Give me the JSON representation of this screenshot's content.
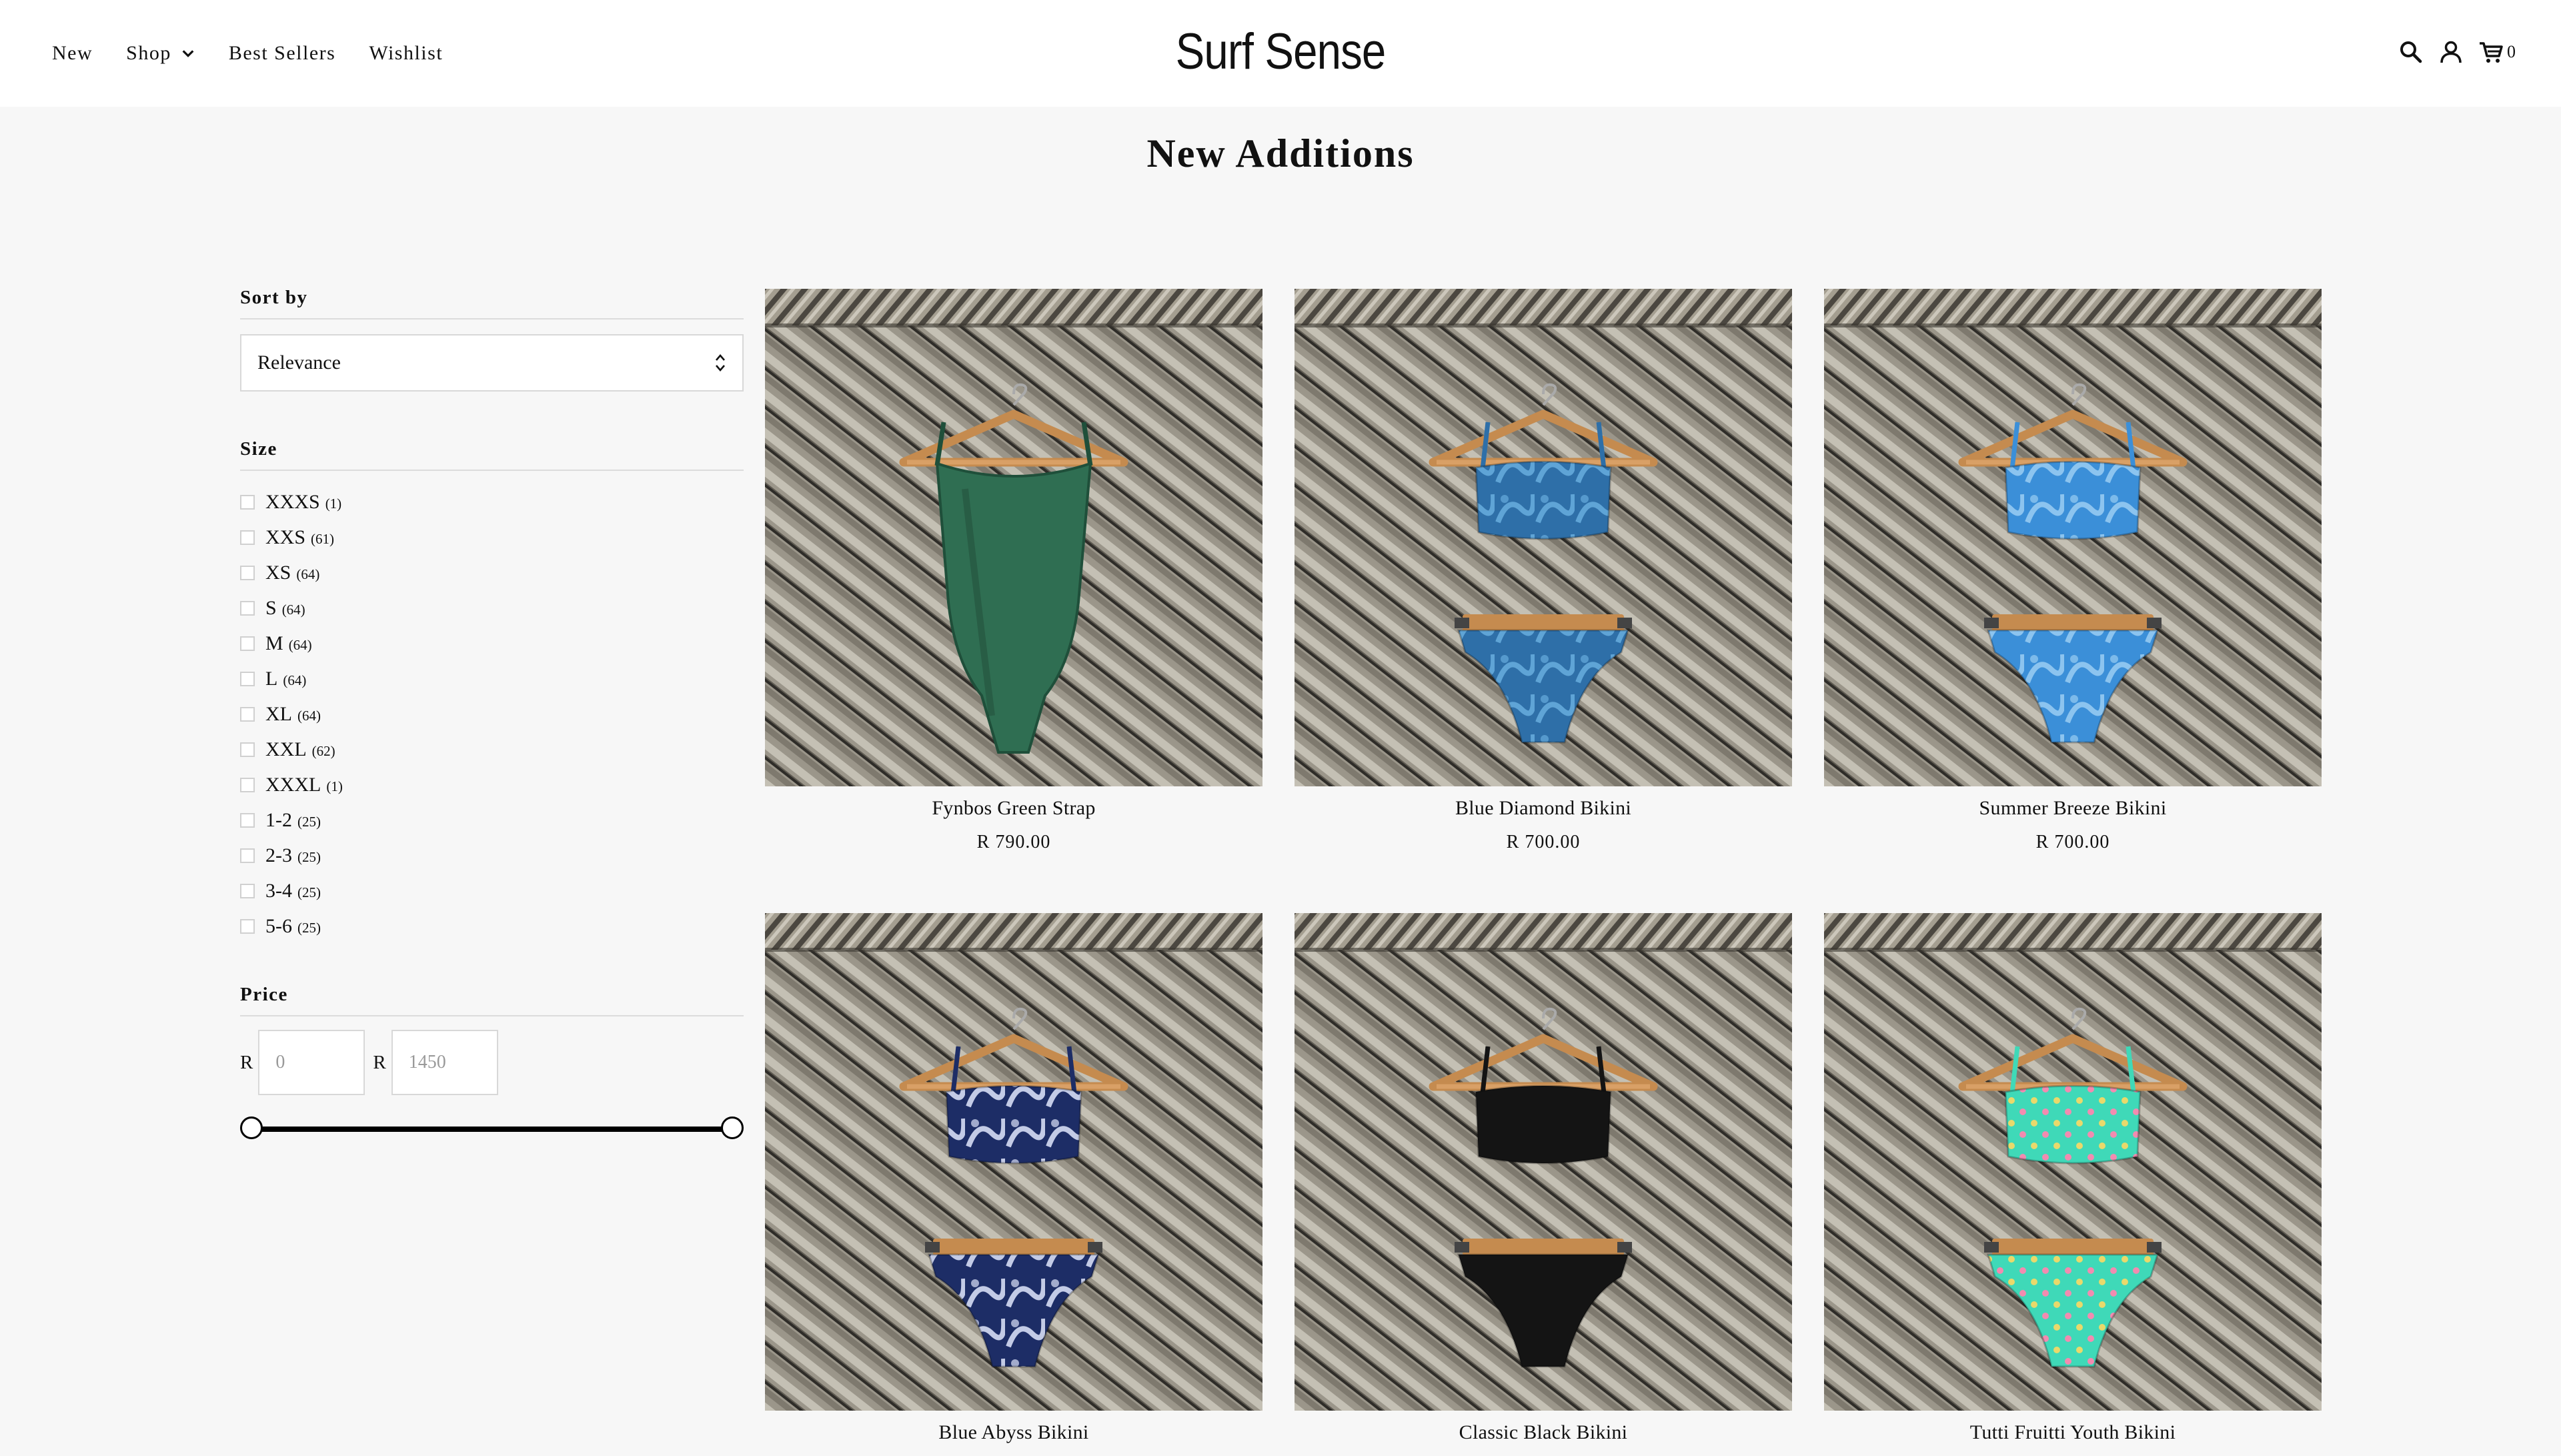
{
  "header": {
    "nav": [
      {
        "label": "New",
        "has_dropdown": false
      },
      {
        "label": "Shop",
        "has_dropdown": true
      },
      {
        "label": "Best Sellers",
        "has_dropdown": false
      },
      {
        "label": "Wishlist",
        "has_dropdown": false
      }
    ],
    "logo": "Surf Sense",
    "icons": [
      "search-icon",
      "account-icon",
      "cart-icon"
    ],
    "cart_count": "0"
  },
  "page_title": "New Additions",
  "sidebar": {
    "sort": {
      "heading": "Sort by",
      "selected": "Relevance"
    },
    "size": {
      "heading": "Size",
      "options": [
        {
          "label": "XXXS",
          "count": "(1)"
        },
        {
          "label": "XXS",
          "count": "(61)"
        },
        {
          "label": "XS",
          "count": "(64)"
        },
        {
          "label": "S",
          "count": "(64)"
        },
        {
          "label": "M",
          "count": "(64)"
        },
        {
          "label": "L",
          "count": "(64)"
        },
        {
          "label": "XL",
          "count": "(64)"
        },
        {
          "label": "XXL",
          "count": "(62)"
        },
        {
          "label": "XXXL",
          "count": "(1)"
        },
        {
          "label": "1-2",
          "count": "(25)"
        },
        {
          "label": "2-3",
          "count": "(25)"
        },
        {
          "label": "3-4",
          "count": "(25)"
        },
        {
          "label": "5-6",
          "count": "(25)"
        }
      ]
    },
    "price": {
      "heading": "Price",
      "currency": "R",
      "min_placeholder": "0",
      "max_placeholder": "1450",
      "range_low_fraction": 0,
      "range_high_fraction": 1
    }
  },
  "products": [
    {
      "name": "Fynbos Green Strap",
      "price": "R 790.00",
      "kind": "onepiece",
      "colors": [
        "#2f6e52",
        "#1f4f3a"
      ],
      "pattern": "solid"
    },
    {
      "name": "Blue Diamond Bikini",
      "price": "R 700.00",
      "kind": "bikini",
      "colors": [
        "#2e6fa8",
        "#5fa4d6"
      ],
      "pattern": "print"
    },
    {
      "name": "Summer Breeze Bikini",
      "price": "R 700.00",
      "kind": "bikini",
      "colors": [
        "#3b8fd8",
        "#8cc4ef"
      ],
      "pattern": "print"
    },
    {
      "name": "Blue Abyss Bikini",
      "price": "",
      "kind": "bikini",
      "colors": [
        "#1d2d66",
        "#c3cbe6"
      ],
      "pattern": "print"
    },
    {
      "name": "Classic Black Bikini",
      "price": "",
      "kind": "bikini",
      "colors": [
        "#141414",
        "#2a2a2a"
      ],
      "pattern": "solid"
    },
    {
      "name": "Tutti Fruitti Youth Bikini",
      "price": "",
      "kind": "bikini",
      "colors": [
        "#3fd9b8",
        "#e9d96b"
      ],
      "pattern": "dots"
    }
  ]
}
